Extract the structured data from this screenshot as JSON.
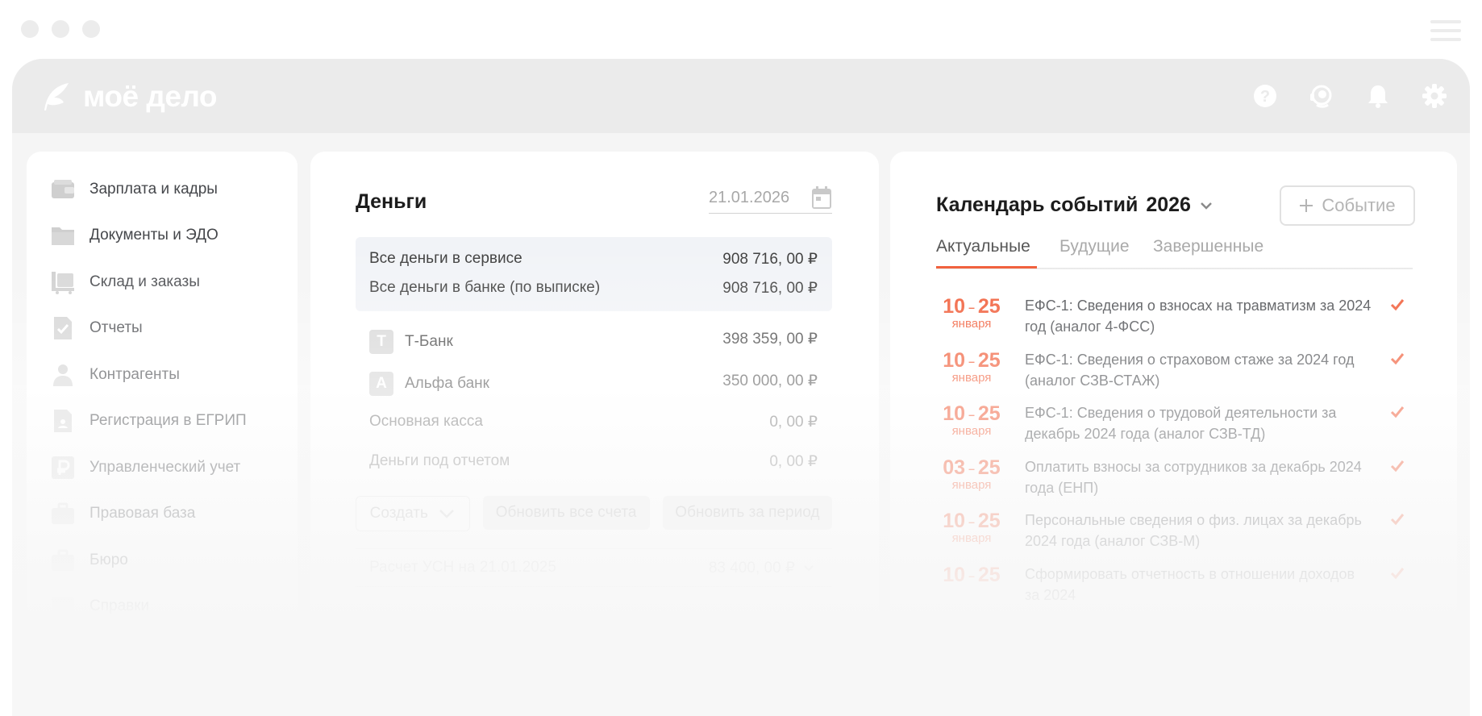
{
  "brand": {
    "logo_text": "моё дело"
  },
  "header_icons": [
    "question-icon",
    "support-icon",
    "bell-icon",
    "gear-icon"
  ],
  "sidebar": {
    "items": [
      {
        "label": "Зарплата и кадры",
        "icon": "wallet-icon"
      },
      {
        "label": "Документы и ЭДО",
        "icon": "folder-icon"
      },
      {
        "label": "Склад и заказы",
        "icon": "cart-icon"
      },
      {
        "label": "Отчеты",
        "icon": "report-icon"
      },
      {
        "label": "Контрагенты",
        "icon": "person-icon"
      },
      {
        "label": "Регистрация в ЕГРИП",
        "icon": "registration-icon"
      },
      {
        "label": "Управленческий учет",
        "icon": "ruble-icon"
      },
      {
        "label": "Правовая база",
        "icon": "briefcase-icon"
      },
      {
        "label": "Бюро",
        "icon": "briefcase-icon"
      },
      {
        "label": "Справки",
        "icon": "calendar-icon"
      }
    ]
  },
  "money": {
    "title": "Деньги",
    "date": "21.01.2026",
    "totals": [
      {
        "label": "Все деньги в сервисе",
        "value": "908 716, 00 ₽"
      },
      {
        "label": "Все деньги в банке (по выписке)",
        "value": "908 716, 00 ₽"
      }
    ],
    "accounts": [
      {
        "label": "Т-Банк",
        "value": "398 359, 00 ₽",
        "icon_letter": "Т"
      },
      {
        "label": "Альфа банк",
        "value": "350 000, 00 ₽",
        "icon_letter": "А"
      },
      {
        "label": "Основная касса",
        "value": "0, 00 ₽"
      },
      {
        "label": "Деньги под отчетом",
        "value": "0, 00 ₽"
      }
    ],
    "buttons": {
      "create": "Создать",
      "refresh_all": "Обновить все счета",
      "refresh_period": "Обновить за период"
    },
    "usn": {
      "label": "Расчет УСН на 21.01.2025",
      "value": "83 400, 00 ₽"
    }
  },
  "calendar": {
    "title": "Календарь событий",
    "year": "2026",
    "event_button": "Событие",
    "tabs": [
      "Актуальные",
      "Будущие",
      "Завершенные"
    ],
    "accent_color": "#f0552f",
    "events": [
      {
        "from": "10",
        "to": "25",
        "month": "января",
        "text": "ЕФС-1: Сведения о взносах на травматизм за 2024 год (аналог 4-ФСС)"
      },
      {
        "from": "10",
        "to": "25",
        "month": "января",
        "text": "ЕФС-1: Сведения о страховом стаже за 2024 год (аналог СЗВ-СТАЖ)"
      },
      {
        "from": "10",
        "to": "25",
        "month": "января",
        "text": "ЕФС-1: Сведения о трудовой деятельности за декабрь 2024 года (аналог СЗВ-ТД)"
      },
      {
        "from": "03",
        "to": "25",
        "month": "января",
        "text": "Оплатить взносы за сотрудников за декабрь 2024 года (ЕНП)"
      },
      {
        "from": "10",
        "to": "25",
        "month": "января",
        "text": "Персональные сведения о физ. лицах за декабрь 2024 года (аналог СЗВ-М)"
      },
      {
        "from": "10",
        "to": "25",
        "month": "",
        "text": "Сформировать отчетность в отношении доходов за 2024"
      }
    ]
  }
}
